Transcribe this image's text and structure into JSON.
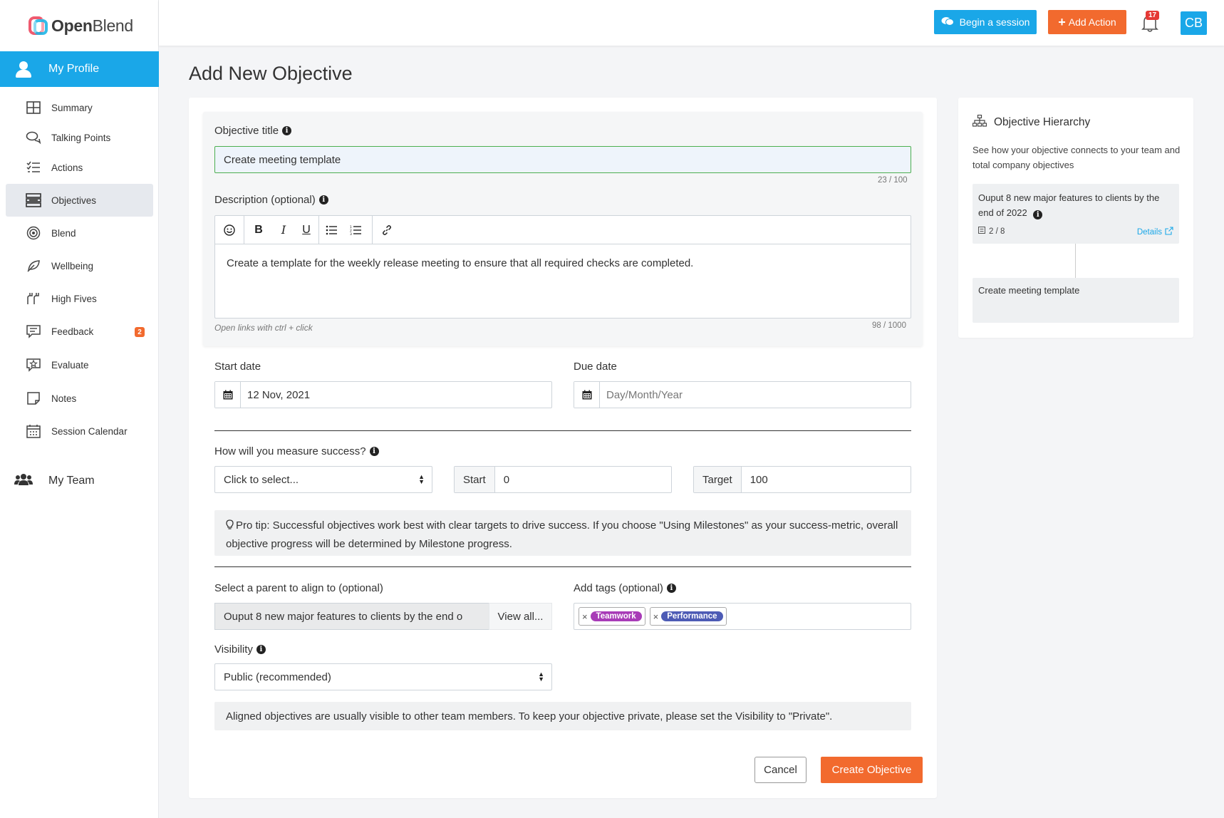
{
  "brand": {
    "name_bold": "Open",
    "name_light": "Blend"
  },
  "sidebar": {
    "profile_label": "My Profile",
    "items": [
      {
        "label": "Summary",
        "icon": "grid-icon"
      },
      {
        "label": "Talking Points",
        "icon": "chat-bubbles-icon"
      },
      {
        "label": "Actions",
        "icon": "checklist-icon"
      },
      {
        "label": "Objectives",
        "icon": "stack-icon"
      },
      {
        "label": "Blend",
        "icon": "target-icon"
      },
      {
        "label": "Wellbeing",
        "icon": "leaf-icon"
      },
      {
        "label": "High Fives",
        "icon": "hands-icon"
      },
      {
        "label": "Feedback",
        "icon": "feedback-icon",
        "badge": "2"
      },
      {
        "label": "Evaluate",
        "icon": "star-board-icon"
      },
      {
        "label": "Notes",
        "icon": "note-icon"
      },
      {
        "label": "Session Calendar",
        "icon": "calendar-icon"
      }
    ],
    "team_label": "My Team"
  },
  "topbar": {
    "session_label": "Begin a session",
    "add_action_label": "Add Action",
    "notifications_count": "17",
    "avatar_initials": "CB"
  },
  "page": {
    "title": "Add New Objective"
  },
  "form": {
    "objective_title_label": "Objective title",
    "objective_title_value": "Create meeting template",
    "objective_title_counter": "23 / 100",
    "description_label": "Description (optional)",
    "description_value": "Create a template for the weekly release meeting to ensure that all required checks are completed.",
    "description_hint": "Open links with ctrl + click",
    "description_counter": "98 / 1000",
    "start_date_label": "Start date",
    "start_date_value": "12 Nov, 2021",
    "due_date_label": "Due date",
    "due_date_placeholder": "Day/Month/Year",
    "measure_label": "How will you measure success?",
    "measure_value": "Click to select...",
    "start_label": "Start",
    "start_value": "0",
    "target_label": "Target",
    "target_value": "100",
    "pro_tip": "Pro tip: Successful objectives work best with clear targets to drive success. If you choose \"Using Milestones\" as your success-metric, overall objective progress will be determined by Milestone progress.",
    "parent_label": "Select a parent to align to (optional)",
    "parent_value": "Ouput 8 new major features to clients by the end o",
    "parent_view_all": "View all...",
    "tags_label": "Add tags (optional)",
    "tags": [
      {
        "label": "Teamwork",
        "color": "#a83bb7"
      },
      {
        "label": "Performance",
        "color": "#4d5bb5"
      }
    ],
    "visibility_label": "Visibility",
    "visibility_value": "Public (recommended)",
    "visibility_note": "Aligned objectives are usually visible to other team members. To keep your objective private, please set the Visibility to \"Private\".",
    "cancel_label": "Cancel",
    "create_label": "Create Objective"
  },
  "hierarchy": {
    "title": "Objective Hierarchy",
    "description": "See how your objective connects to your team and total company objectives",
    "parent_title": "Ouput 8 new major features to clients by the end of 2022",
    "parent_count": "2 / 8",
    "details_label": "Details",
    "child_title": "Create meeting template"
  },
  "colors": {
    "accent": "#1aa7e8",
    "action": "#f26a2e"
  }
}
